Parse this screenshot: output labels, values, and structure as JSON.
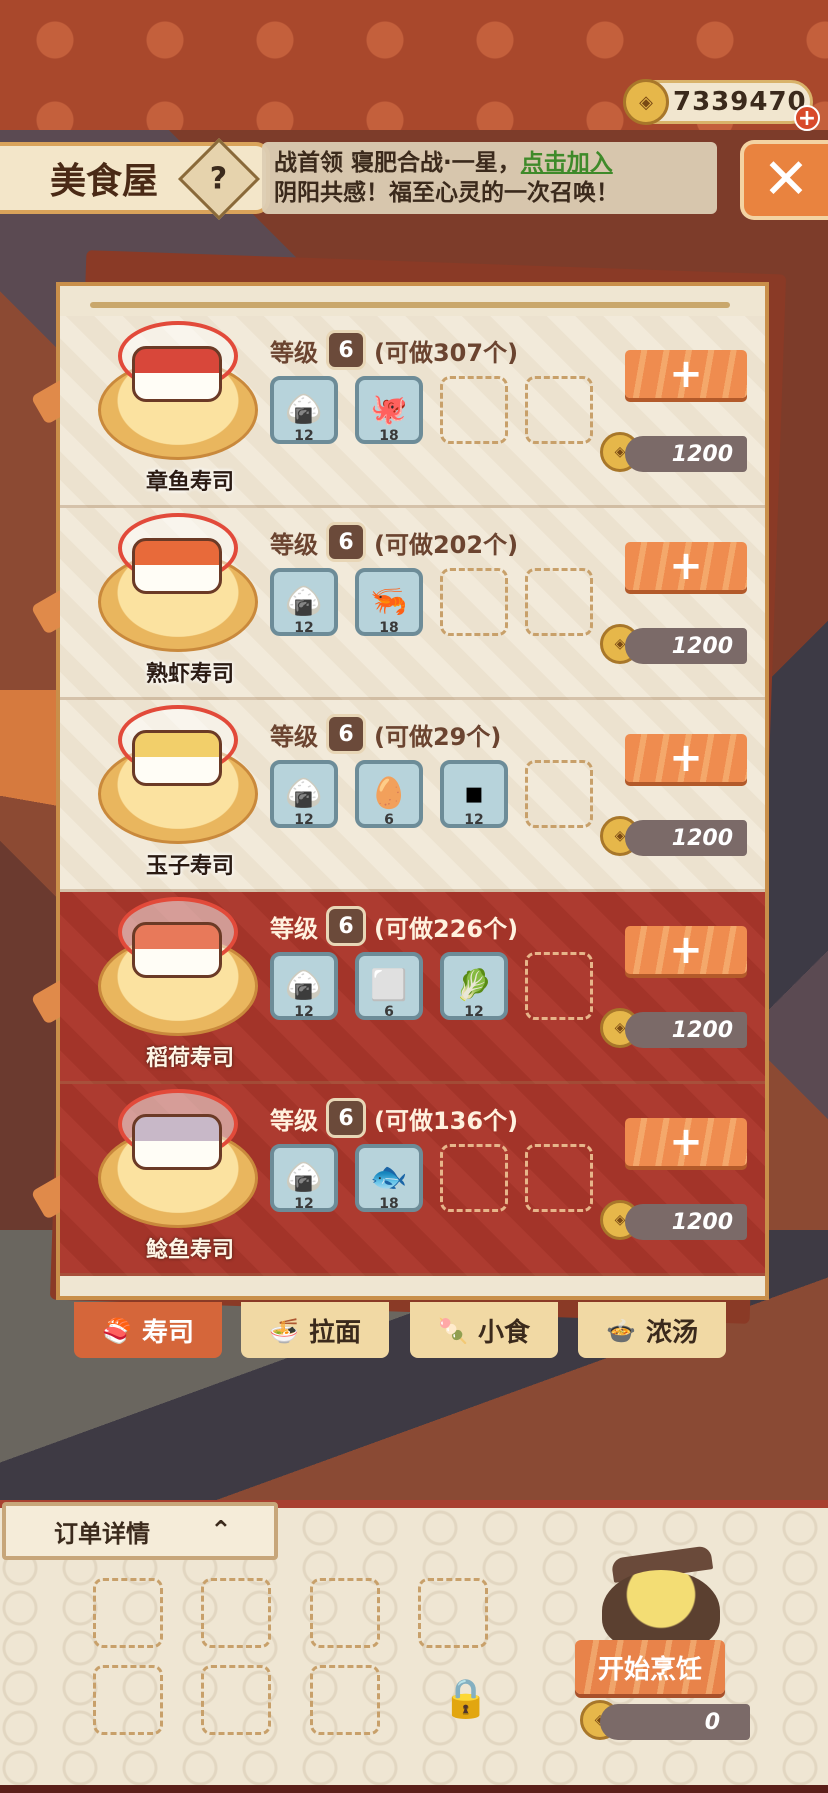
{
  "header": {
    "coins": "7339470",
    "coin_plus": "+",
    "title": "美食屋",
    "help": "?",
    "news_line1": "战首领 寝肥合战·一星，",
    "news_link": "点击加入",
    "news_line2": "阴阳共感！福至心灵的一次召唤！",
    "close": "✕"
  },
  "dishes": [
    {
      "name": "章鱼寿司",
      "level_label": "等级",
      "level": "6",
      "can_make": "(可做307个)",
      "price": "1200",
      "sushi_color": "#d8473a",
      "ingredients": [
        {
          "icon": "rice-ball",
          "glyph": "🍙",
          "count": "12"
        },
        {
          "icon": "octopus",
          "glyph": "🐙",
          "count": "18"
        }
      ]
    },
    {
      "name": "熟虾寿司",
      "level_label": "等级",
      "level": "6",
      "can_make": "(可做202个)",
      "price": "1200",
      "sushi_color": "#e86a3a",
      "ingredients": [
        {
          "icon": "rice-ball",
          "glyph": "🍙",
          "count": "12"
        },
        {
          "icon": "shrimp",
          "glyph": "🦐",
          "count": "18"
        }
      ]
    },
    {
      "name": "玉子寿司",
      "level_label": "等级",
      "level": "6",
      "can_make": "(可做29个)",
      "price": "1200",
      "sushi_color": "#f2cf6a",
      "ingredients": [
        {
          "icon": "rice-ball",
          "glyph": "🍙",
          "count": "12"
        },
        {
          "icon": "egg",
          "glyph": "🥚",
          "count": "6"
        },
        {
          "icon": "seaweed",
          "glyph": "▪",
          "count": "12"
        }
      ]
    },
    {
      "name": "稻荷寿司",
      "level_label": "等级",
      "level": "6",
      "can_make": "(可做226个)",
      "price": "1200",
      "sushi_color": "#e8795a",
      "ingredients": [
        {
          "icon": "rice-ball",
          "glyph": "🍙",
          "count": "12"
        },
        {
          "icon": "tofu",
          "glyph": "⬜",
          "count": "6"
        },
        {
          "icon": "radish",
          "glyph": "🥬",
          "count": "12"
        }
      ]
    },
    {
      "name": "鲶鱼寿司",
      "level_label": "等级",
      "level": "6",
      "can_make": "(可做136个)",
      "price": "1200",
      "sushi_color": "#c8b8c8",
      "ingredients": [
        {
          "icon": "rice-ball",
          "glyph": "🍙",
          "count": "12"
        },
        {
          "icon": "catfish",
          "glyph": "🐟",
          "count": "18"
        }
      ]
    }
  ],
  "tabs": [
    {
      "label": "寿司",
      "icon": "sushi-icon",
      "glyph": "🍣",
      "active": true
    },
    {
      "label": "拉面",
      "icon": "ramen-icon",
      "glyph": "🍜",
      "active": false
    },
    {
      "label": "小食",
      "icon": "snack-icon",
      "glyph": "🍡",
      "active": false
    },
    {
      "label": "浓汤",
      "icon": "soup-icon",
      "glyph": "🍲",
      "active": false
    }
  ],
  "order": {
    "title": "订单详情",
    "chevron": "⌃",
    "cook_label": "开始烹饪",
    "cook_price": "0",
    "lock_glyph": "🔒"
  },
  "colors": {
    "accent_orange": "#e9833f",
    "link_green": "#3f8a2a",
    "row_dark": "#ad3b30",
    "row_light": "#f2eada"
  }
}
